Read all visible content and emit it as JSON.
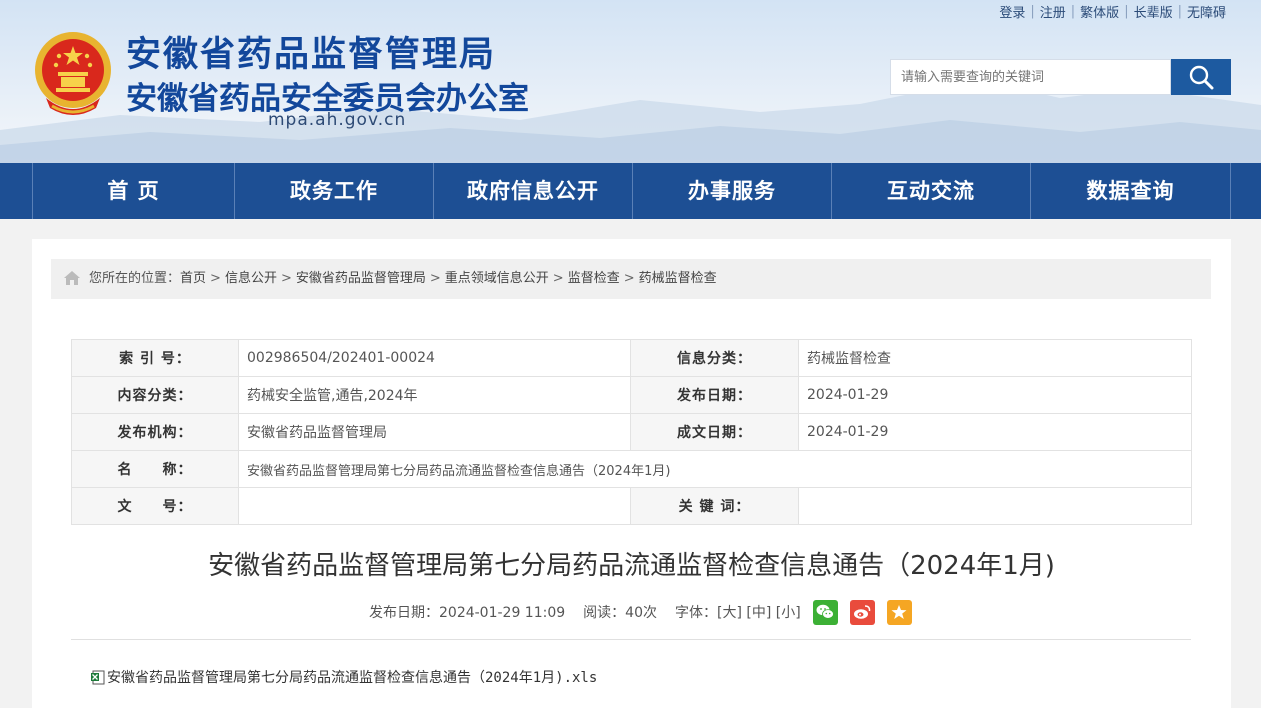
{
  "header": {
    "title_main": "安徽省药品监督管理局",
    "title_sub": "安徽省药品安全委员会办公室",
    "domain": "mpa.ah.gov.cn",
    "emblem_icon": "national-emblem-icon",
    "top_links": [
      "登录",
      "注册",
      "繁体版",
      "长辈版",
      "无障碍"
    ],
    "search": {
      "placeholder": "请输入需要查询的关键词",
      "icon": "search-icon"
    }
  },
  "nav": {
    "items": [
      "首 页",
      "政务工作",
      "政府信息公开",
      "办事服务",
      "互动交流",
      "数据查询"
    ]
  },
  "breadcrumb": {
    "icon": "home-icon",
    "prefix": "您所在的位置：",
    "items": [
      "首页",
      "信息公开",
      "安徽省药品监督管理局",
      "重点领域信息公开",
      "监督检查",
      "药械监督检查"
    ]
  },
  "meta": {
    "index_label": "索 引 号：",
    "index_value": "002986504/202401-00024",
    "category_label": "信息分类：",
    "category_value": "药械监督检查",
    "content_type_label": "内容分类：",
    "content_type_value": "药械安全监管,通告,2024年",
    "publish_date_label": "发布日期：",
    "publish_date_value": "2024-01-29",
    "issuer_label": "发布机构：",
    "issuer_value": "安徽省药品监督管理局",
    "created_date_label": "成文日期：",
    "created_date_value": "2024-01-29",
    "name_label": "名　　称：",
    "name_value": "安徽省药品监督管理局第七分局药品流通监督检查信息通告（2024年1月)",
    "doc_no_label": "文　　号：",
    "doc_no_value": "",
    "keywords_label": "关 键 词：",
    "keywords_value": ""
  },
  "article": {
    "title": "安徽省药品监督管理局第七分局药品流通监督检查信息通告（2024年1月)",
    "publish_info": "发布日期：2024-01-29 11:09",
    "views": "阅读：40次",
    "font_size_label": "字体：",
    "font_large": "[大]",
    "font_medium": "[中]",
    "font_small": "[小]",
    "share_icons": [
      "wechat-icon",
      "weibo-icon",
      "favorite-icon"
    ],
    "attachment": "安徽省药品监督管理局第七分局药品流通监督检查信息通告（2024年1月).xls"
  },
  "colors": {
    "brand_blue": "#1d4f94",
    "title_blue": "#12479b",
    "wechat_green": "#3cb035",
    "weibo_red": "#e94b3c",
    "favorite_orange": "#f5a623"
  }
}
